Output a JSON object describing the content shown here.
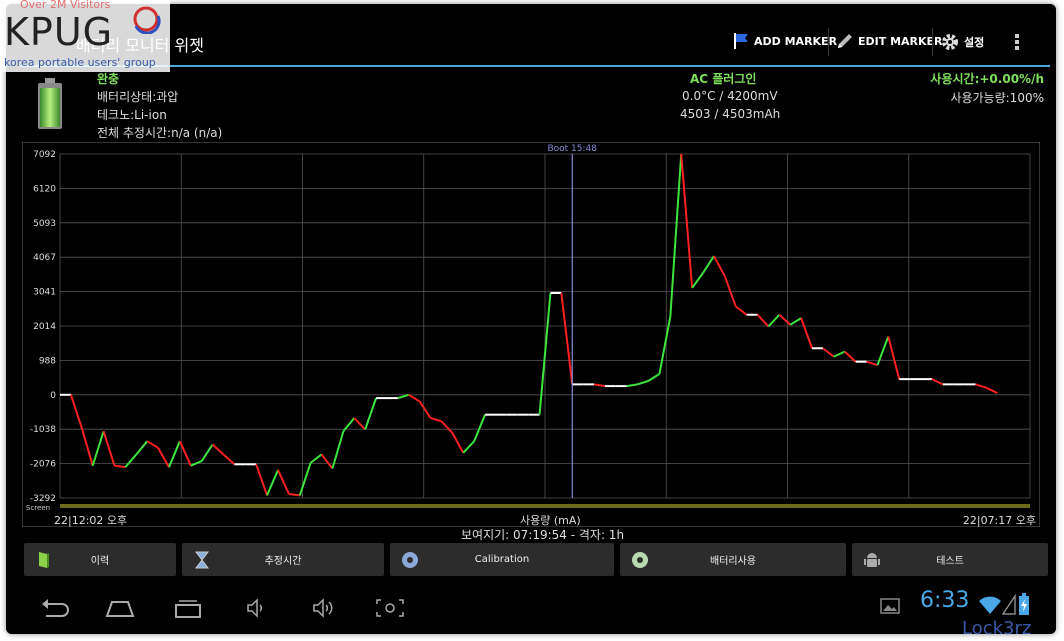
{
  "watermark": {
    "visitors": "Over 2M Visitors",
    "logo": "KPUG",
    "sub": "korea portable users' group",
    "credit": "Lock3rz"
  },
  "app": {
    "title": "배터리 모니터 위젯"
  },
  "actions": {
    "add_marker": "ADD MARKER",
    "edit_marker": "EDIT MARKER",
    "settings": "설정"
  },
  "status": {
    "charge_state": "완충",
    "battery_state": "배터리상태:과압",
    "technology": "테크노:Li-ion",
    "total_estimate": "전체 추정시간:n/a (n/a)",
    "power_source": "AC 플러그인",
    "temp_voltage": "0.0°C / 4200mV",
    "capacity": "4503 / 4503mAh",
    "usage_rate": "사용시간:+0.00%/h",
    "available": "사용가능량:100%"
  },
  "chart_footer": {
    "screen_label": "Screen",
    "left_time": "22|12:02 오후",
    "x_label": "사용량 (mA)",
    "right_time": "22|07:17 오후",
    "view_info": "보여지기: 07:19:54 - 격자: 1h"
  },
  "chart_data": {
    "type": "line",
    "marker_label": "Boot 15:48",
    "yticks": [
      7092,
      6120,
      5093,
      4067,
      3041,
      2014,
      988,
      0,
      -1038,
      -2076,
      -3292
    ],
    "ylim": [
      -3292,
      7092
    ],
    "xlim": [
      0,
      89
    ],
    "marker_x": 47,
    "grid": true,
    "colors": {
      "up": "#3de63d",
      "down": "#ff2020",
      "flat": "#ffffff",
      "grid": "#555555",
      "marker": "#8a8ad8"
    },
    "points": [
      [
        0,
        0
      ],
      [
        1,
        0
      ],
      [
        2,
        -1000
      ],
      [
        3,
        -2150
      ],
      [
        4,
        -1100
      ],
      [
        5,
        -2150
      ],
      [
        6,
        -2200
      ],
      [
        7,
        -1800
      ],
      [
        8,
        -1400
      ],
      [
        9,
        -1600
      ],
      [
        10,
        -2200
      ],
      [
        11,
        -1400
      ],
      [
        12,
        -2150
      ],
      [
        13,
        -2000
      ],
      [
        14,
        -1500
      ],
      [
        15,
        -1800
      ],
      [
        16,
        -2100
      ],
      [
        17,
        -2100
      ],
      [
        18,
        -2100
      ],
      [
        19,
        -3200
      ],
      [
        20,
        -2300
      ],
      [
        21,
        -3150
      ],
      [
        22,
        -3200
      ],
      [
        23,
        -2050
      ],
      [
        24,
        -1800
      ],
      [
        25,
        -2250
      ],
      [
        26,
        -1100
      ],
      [
        27,
        -700
      ],
      [
        28,
        -1050
      ],
      [
        29,
        -100
      ],
      [
        30,
        -100
      ],
      [
        31,
        -100
      ],
      [
        32,
        0
      ],
      [
        33,
        -200
      ],
      [
        34,
        -700
      ],
      [
        35,
        -800
      ],
      [
        36,
        -1150
      ],
      [
        37,
        -1750
      ],
      [
        38,
        -1400
      ],
      [
        39,
        -600
      ],
      [
        40,
        -600
      ],
      [
        41,
        -600
      ],
      [
        42,
        -600
      ],
      [
        43,
        -600
      ],
      [
        44,
        -600
      ],
      [
        45,
        3000
      ],
      [
        46,
        3000
      ],
      [
        47,
        300
      ],
      [
        48,
        300
      ],
      [
        49,
        300
      ],
      [
        50,
        250
      ],
      [
        51,
        250
      ],
      [
        52,
        250
      ],
      [
        53,
        300
      ],
      [
        54,
        400
      ],
      [
        55,
        600
      ],
      [
        56,
        2300
      ],
      [
        57,
        7092
      ],
      [
        58,
        3150
      ],
      [
        59,
        3600
      ],
      [
        60,
        4100
      ],
      [
        61,
        3500
      ],
      [
        62,
        2600
      ],
      [
        63,
        2350
      ],
      [
        64,
        2350
      ],
      [
        65,
        2000
      ],
      [
        66,
        2350
      ],
      [
        67,
        2050
      ],
      [
        68,
        2250
      ],
      [
        69,
        1350
      ],
      [
        70,
        1350
      ],
      [
        71,
        1100
      ],
      [
        72,
        1250
      ],
      [
        73,
        950
      ],
      [
        74,
        950
      ],
      [
        75,
        850
      ],
      [
        76,
        1700
      ],
      [
        77,
        450
      ],
      [
        78,
        450
      ],
      [
        79,
        450
      ],
      [
        80,
        450
      ],
      [
        81,
        300
      ],
      [
        82,
        300
      ],
      [
        83,
        300
      ],
      [
        84,
        300
      ],
      [
        85,
        200
      ],
      [
        86,
        50
      ]
    ]
  },
  "bottom_buttons": [
    {
      "label": "이력",
      "icon": "book-icon"
    },
    {
      "label": "추정시간",
      "icon": "hourglass-icon"
    },
    {
      "label": "Calibration",
      "icon": "disc-icon"
    },
    {
      "label": "배터리사용",
      "icon": "cd-icon"
    },
    {
      "label": "테스트",
      "icon": "android-icon"
    }
  ],
  "system": {
    "time": "6:33"
  }
}
